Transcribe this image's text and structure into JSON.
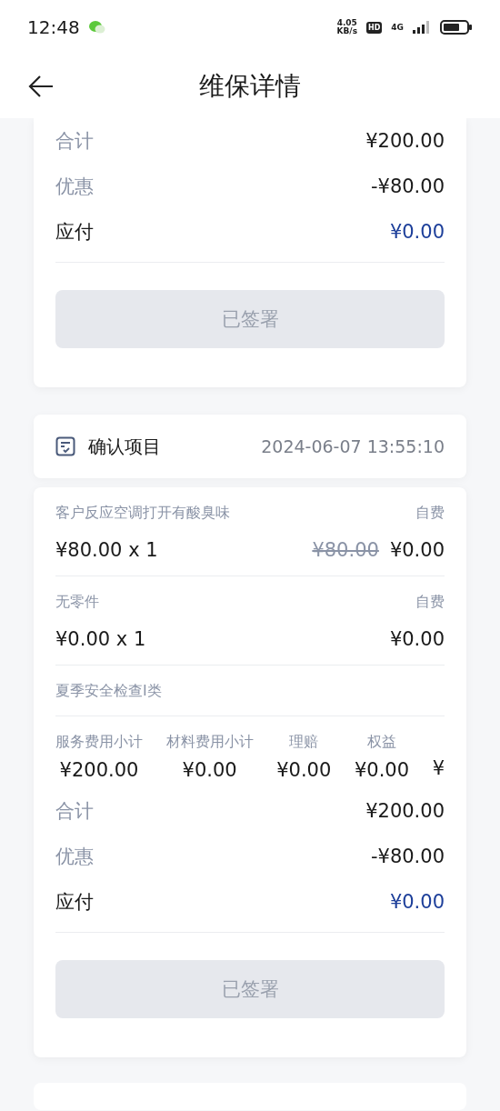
{
  "status_bar": {
    "time": "12:48",
    "speed_value": "4.05",
    "speed_unit": "KB/s",
    "hd": "HD",
    "network": "4G"
  },
  "header": {
    "title": "维保详情"
  },
  "summary_card": {
    "totals": [
      {
        "kind": "total",
        "label": "合计",
        "value": "¥200.00"
      },
      {
        "kind": "discount",
        "label": "优惠",
        "value": "-¥80.00"
      },
      {
        "kind": "payable",
        "label": "应付",
        "value": "¥0.00"
      }
    ],
    "button": {
      "label": "已签署",
      "disabled": true
    }
  },
  "confirm_section": {
    "title": "确认项目",
    "time": "2024-06-07 13:55:10",
    "items": [
      {
        "name": "客户反应空调打开有酸臭味",
        "payer": "自费",
        "price_qty": "¥80.00 x 1",
        "original_price": "¥80.00",
        "amount": "¥0.00"
      },
      {
        "name": "无零件",
        "payer": "自费",
        "price_qty": "¥0.00 x 1",
        "amount": "¥0.00"
      },
      {
        "name": "夏季安全检查I类"
      }
    ],
    "subtotals": [
      {
        "label": "服务费用小计",
        "value": "¥200.00"
      },
      {
        "label": "材料费用小计",
        "value": "¥0.00"
      },
      {
        "label": "理赔",
        "value": "¥0.00"
      },
      {
        "label": "权益",
        "value": "¥0.00"
      },
      {
        "value": "¥"
      }
    ],
    "totals": [
      {
        "kind": "total",
        "label": "合计",
        "value": "¥200.00"
      },
      {
        "kind": "discount",
        "label": "优惠",
        "value": "-¥80.00"
      },
      {
        "kind": "payable",
        "label": "应付",
        "value": "¥0.00"
      }
    ],
    "button": {
      "label": "已签署",
      "disabled": true
    }
  }
}
